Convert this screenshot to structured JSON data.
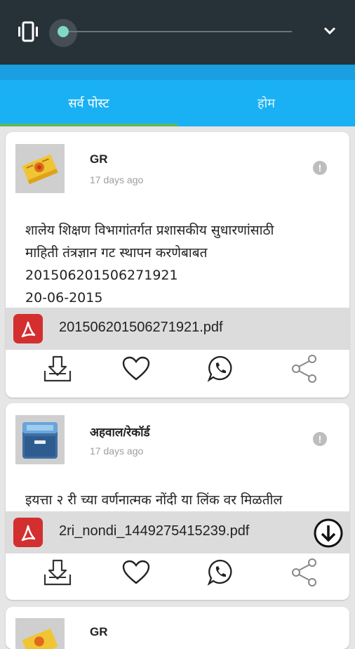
{
  "tabs": [
    {
      "label": "सर्व पोस्ट"
    },
    {
      "label": "होम"
    }
  ],
  "posts": [
    {
      "title": "GR",
      "time": "17 days ago",
      "body": "शालेय शिक्षण विभागांतर्गत प्रशासकीय सुधारणांसाठी\nमाहिती तंत्रज्ञान गट स्थापन करणेबाबत\n201506201506271921\n20-06-2015",
      "file": "201506201506271921.pdf",
      "thumb_icon": "gr-document-icon"
    },
    {
      "title": "अहवाल/रेकॉर्ड",
      "time": "17 days ago",
      "body": "इयत्ता २ री च्या वर्णनात्मक नोंदी या लिंक वर मिळतील",
      "file": "2ri_nondi_1449275415239.pdf",
      "thumb_icon": "file-cabinet-icon"
    },
    {
      "title": "GR"
    }
  ],
  "colors": {
    "statusbar": "#263238",
    "tab_bg": "#1ab1f4",
    "tab_indicator": "#5cb85c",
    "pdf_red": "#d32f2f"
  }
}
